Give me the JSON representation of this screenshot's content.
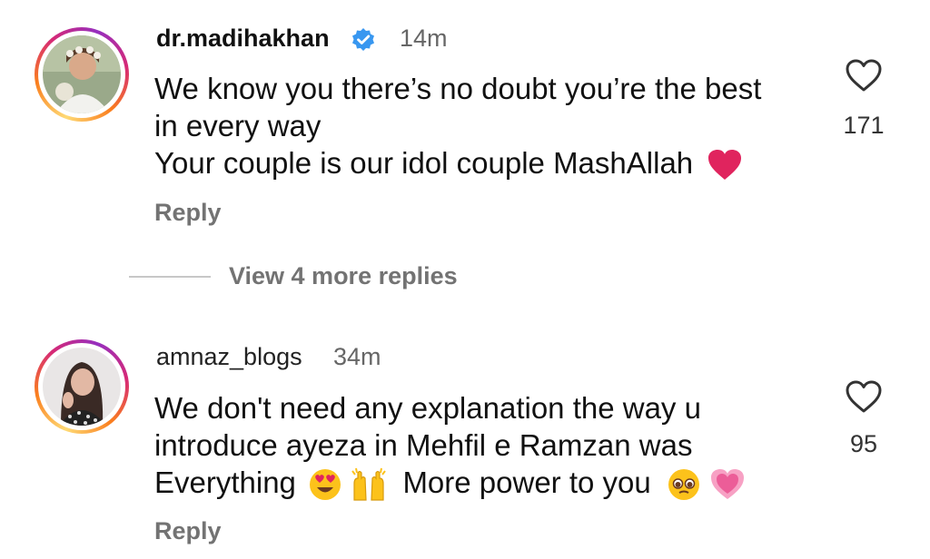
{
  "comments": [
    {
      "username": "dr.madihakhan",
      "verified": true,
      "time": "14m",
      "lines": [
        "We know you there’s no doubt you’re the best",
        "in every way",
        "Your couple is our idol couple MashAllah"
      ],
      "emoji_names": [
        "red-heart-emoji"
      ],
      "reply_label": "Reply",
      "likes": "171",
      "view_replies_label": "View 4 more replies"
    },
    {
      "username": "amnaz_blogs",
      "verified": false,
      "time": "34m",
      "lines": [
        "We don't need any explanation the way u",
        "introduce ayeza in Mehfil e Ramzan was",
        "Everything",
        "More power to you"
      ],
      "emoji_names": [
        "heart-eyes-emoji",
        "raised-hands-emoji",
        "pleading-face-emoji",
        "growing-heart-emoji"
      ],
      "reply_label": "Reply",
      "likes": "95"
    }
  ],
  "colors": {
    "verified_badge": "#3897f0",
    "secondary_text": "#737373",
    "emoji_heart": "#e0245e"
  }
}
